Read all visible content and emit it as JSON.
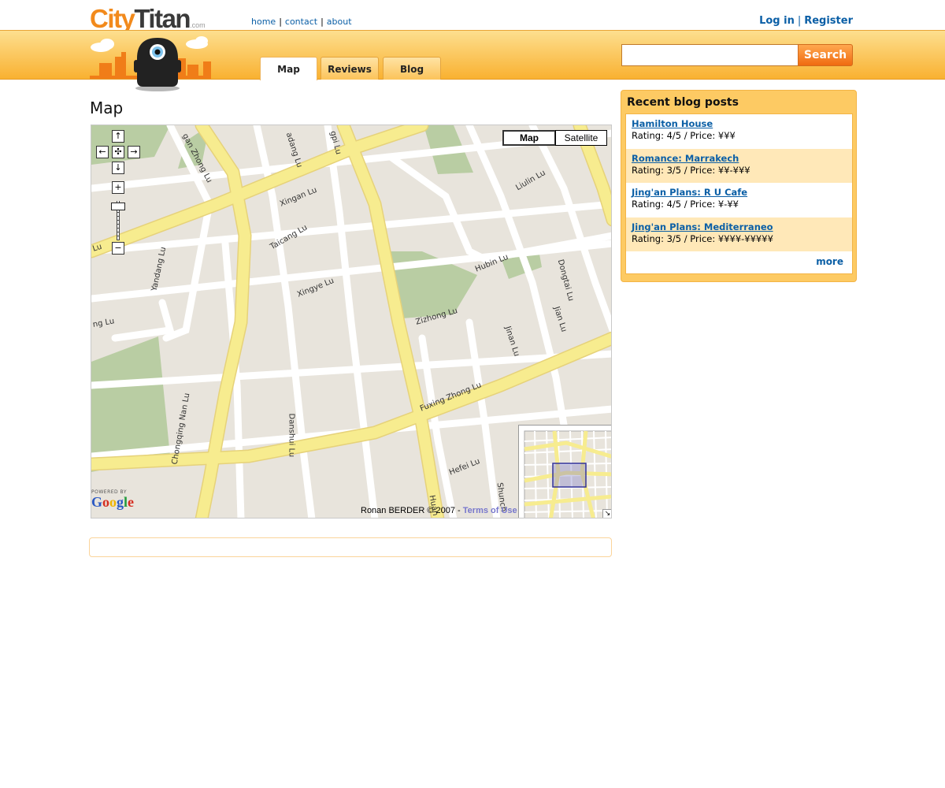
{
  "brand": {
    "city": "City",
    "titan": "Titan",
    "dotcom": ".com"
  },
  "top_nav": {
    "home": "home",
    "contact": "contact",
    "about": "about",
    "sep": "|"
  },
  "auth": {
    "login": "Log in",
    "sep": "|",
    "register": "Register"
  },
  "tabs": [
    {
      "label": "Map",
      "active": true
    },
    {
      "label": "Reviews",
      "active": false
    },
    {
      "label": "Blog",
      "active": false
    }
  ],
  "search": {
    "value": "",
    "placeholder": "",
    "button_label": "Search"
  },
  "main": {
    "title": "Map"
  },
  "map": {
    "type_buttons": {
      "map": "Map",
      "satellite": "Satellite",
      "active": "Map"
    },
    "powered_by": "POWERED BY",
    "google_logo": "Google",
    "copyright": "Ronan BERDER © 2007 - ",
    "terms": "Terms of Use",
    "pan_icons": [
      "pan-up-icon",
      "pan-left-icon",
      "pan-center-icon",
      "pan-right-icon",
      "pan-down-icon"
    ],
    "street_labels": {
      "yanan_zhong": "gan Zhong Lu",
      "xiangyang": "adang Lu",
      "sipi": "gpi Lu",
      "xingan": "Xingan Lu",
      "liulin": "Liulin Lu",
      "taicang": "Taicang Lu",
      "dongtai": "Dongtai Lu",
      "yandang": "Yandang Lu",
      "hubin": "Hubin Lu",
      "xingye": "Xingye Lu",
      "zizhong": "Zizhong Lu",
      "jinan": "Jinan Lu",
      "jian": "Jian Lu",
      "left_lu": "Lu",
      "left_ng": "ng Lu",
      "danshui": "Danshui Lu",
      "fuxing_zhong": "Fuxing Zhong Lu",
      "chongqing_nan": "Chongqing Nan Lu",
      "hefei": "Hefei Lu",
      "huang": "Huan",
      "shunch": "Shunch"
    }
  },
  "sidebar": {
    "title": "Recent blog posts",
    "posts": [
      {
        "title": "Hamilton House",
        "info": "Rating: 4/5 / Price: ¥¥¥"
      },
      {
        "title": "Romance: Marrakech",
        "info": "Rating: 3/5 / Price: ¥¥-¥¥¥"
      },
      {
        "title": "Jing'an Plans: R U Cafe",
        "info": "Rating: 4/5 / Price: ¥-¥¥"
      },
      {
        "title": "Jing'an Plans: Mediterraneo",
        "info": "Rating: 3/5 / Price: ¥¥¥¥-¥¥¥¥¥"
      }
    ],
    "more": "more"
  },
  "colors": {
    "accent_orange": "#f28a1c",
    "link_blue": "#0b5fa6",
    "road_yellow": "#f7ec8f",
    "park_green": "#b9cda3"
  }
}
